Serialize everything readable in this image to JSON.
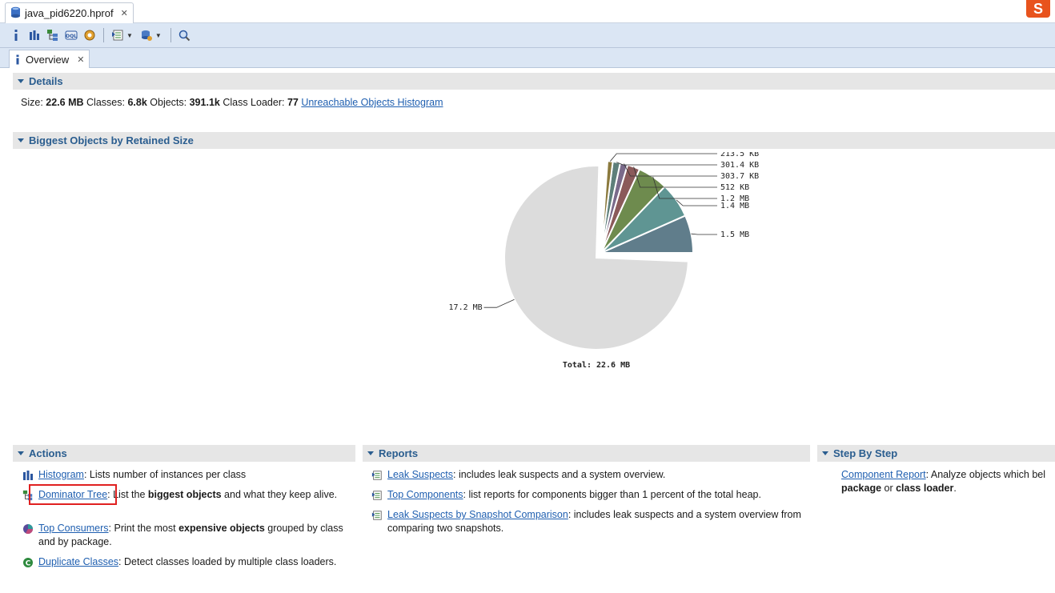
{
  "editor_tab": {
    "title": "java_pid6220.hprof"
  },
  "toolbar": {
    "buttons": [
      "info-icon",
      "histogram-icon",
      "dominator-tree-icon",
      "oql-icon",
      "heap-dump-overview-icon",
      "run-report-icon",
      "query-browser-icon",
      "search-icon"
    ],
    "oql_label": "OQL"
  },
  "inner_tab": {
    "title": "Overview"
  },
  "details": {
    "heading": "Details",
    "size_label": "Size:",
    "size_value": "22.6 MB",
    "classes_label": "Classes:",
    "classes_value": "6.8k",
    "objects_label": "Objects:",
    "objects_value": "391.1k",
    "classloader_label": "Class Loader:",
    "classloader_value": "77",
    "unreachable_link": "Unreachable Objects Histogram"
  },
  "biggest": {
    "heading": "Biggest Objects by Retained Size"
  },
  "chart_data": {
    "type": "pie",
    "title": "",
    "total_label": "Total: 22.6 MB",
    "slices": [
      {
        "label": "1.5 MB",
        "value_kb": 1536,
        "color": "#607d8b"
      },
      {
        "label": "1.4 MB",
        "value_kb": 1434,
        "color": "#5f9593"
      },
      {
        "label": "1.2 MB",
        "value_kb": 1229,
        "color": "#6e8b4e"
      },
      {
        "label": "512 KB",
        "value_kb": 512,
        "color": "#8b5a5a"
      },
      {
        "label": "303.7 KB",
        "value_kb": 303.7,
        "color": "#7a6a8a"
      },
      {
        "label": "301.4 KB",
        "value_kb": 301.4,
        "color": "#5e7f7a"
      },
      {
        "label": "213.5 KB",
        "value_kb": 213.5,
        "color": "#8b7a3e"
      },
      {
        "label": "17.2 MB",
        "value_kb": 17613,
        "color": "#dcdcdc"
      }
    ]
  },
  "actions": {
    "heading": "Actions",
    "items": [
      {
        "link": "Histogram",
        "text": ": Lists number of instances per class"
      },
      {
        "link": "Dominator Tree",
        "pre": ": List the ",
        "bold": "biggest objects",
        "post": " and what they keep alive."
      },
      {
        "link": "Top Consumers",
        "pre": ": Print the most ",
        "bold": "expensive objects",
        "post": " grouped by class and by package."
      },
      {
        "link": "Duplicate Classes",
        "text": ": Detect classes loaded by multiple class loaders."
      }
    ]
  },
  "reports": {
    "heading": "Reports",
    "items": [
      {
        "link": "Leak Suspects",
        "text": ": includes leak suspects and a system overview."
      },
      {
        "link": "Top Components",
        "text": ": list reports for components bigger than 1 percent of the total heap."
      },
      {
        "link": "Leak Suspects by Snapshot Comparison",
        "text": ": includes leak suspects and a system overview from comparing two snapshots."
      }
    ]
  },
  "stepbystep": {
    "heading": "Step By Step",
    "items": [
      {
        "link": "Component Report",
        "pre": ": Analyze objects which bel",
        "bold1": "package",
        "mid": " or ",
        "bold2": "class loader",
        "post": "."
      }
    ]
  },
  "colors": {
    "link": "#1f5fb0",
    "heading": "#2a5d8f",
    "highlight": "#e02020"
  }
}
